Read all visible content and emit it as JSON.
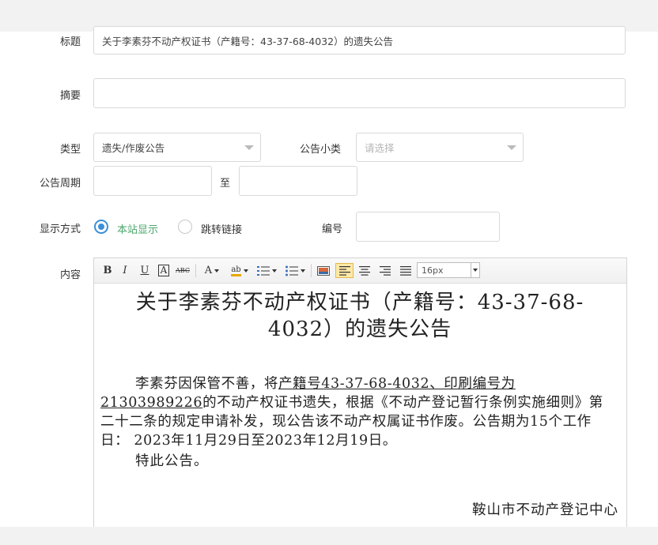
{
  "form": {
    "title_label": "标题",
    "title_value": "关于李素芬不动产权证书（产籍号：43-37-68-4032）的遗失公告",
    "summary_label": "摘要",
    "summary_value": "",
    "type_label": "类型",
    "type_value": "遗失/作废公告",
    "subtype_label": "公告小类",
    "subtype_placeholder": "请选择",
    "period_label": "公告周期",
    "period_to": "至",
    "period_start": "",
    "period_end": "",
    "display_label": "显示方式",
    "display_options": [
      "本站显示",
      "跳转链接"
    ],
    "number_label": "编号",
    "number_value": "",
    "content_label": "内容"
  },
  "editor": {
    "font_size": "16px",
    "toolbar": {
      "bold": "B",
      "italic": "I",
      "underline": "U",
      "border_a": "A",
      "strike": "ABC",
      "font_color": "A",
      "highlight": "ab"
    },
    "content": {
      "title": "关于李素芬不动产权证书（产籍号：43-37-68-4032）的遗失公告",
      "para_start": "李素芬因保管不善，将",
      "para_underlined": "产籍号43-37-68-4032、印刷编号为21303989226",
      "para_rest": "的不动产权证书遗失，根据《不动产登记暂行条例实施细则》第二十二条的规定申请补发，现公告该不动产权属证书作废。公告期为15个工作日：  2023年11月29日至2023年12月19日。",
      "closing": "特此公告。",
      "signer": "鞍山市不动产登记中心"
    }
  },
  "colors": {
    "accent": "#3b8fd9",
    "selected_text": "#4aa66b"
  }
}
